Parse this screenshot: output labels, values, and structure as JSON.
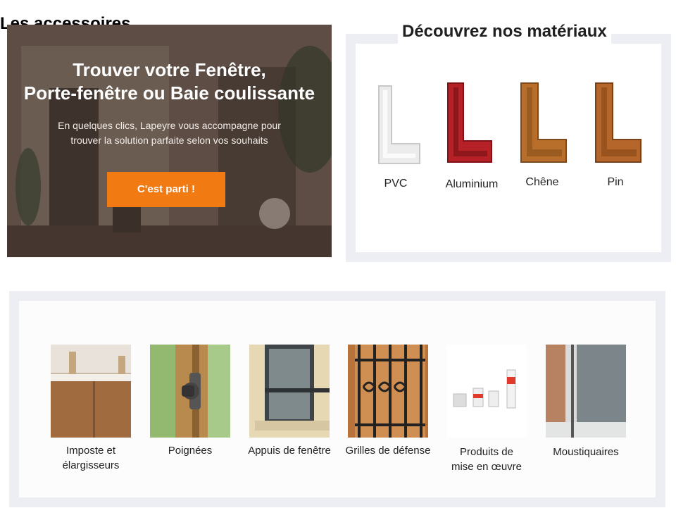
{
  "hero": {
    "title_line1": "Trouver votre Fenêtre,",
    "title_line2": "Porte-fenêtre ou Baie coulissante",
    "subtitle_line1": "En quelques clics, Lapeyre vous accompagne pour",
    "subtitle_line2": "trouver la solution parfaite selon vos souhaits",
    "cta_label": "C'est parti !",
    "accent_color": "#f27a12"
  },
  "materials": {
    "title": "Découvrez nos matériaux",
    "items": [
      {
        "label": "PVC",
        "color": "#f1f1f1"
      },
      {
        "label": "Aluminium",
        "color": "#b52126"
      },
      {
        "label": "Chêne",
        "color": "#b86f2c"
      },
      {
        "label": "Pin",
        "color": "#b5662a"
      }
    ]
  },
  "accessories": {
    "title": "Les accessoires",
    "items": [
      {
        "label_line1": "Imposte et",
        "label_line2": "élargisseurs"
      },
      {
        "label_line1": "Poignées",
        "label_line2": ""
      },
      {
        "label_line1": "Appuis de fenêtre",
        "label_line2": ""
      },
      {
        "label_line1": "Grilles de défense",
        "label_line2": ""
      },
      {
        "label_line1": "Produits de",
        "label_line2": "mise en œuvre"
      },
      {
        "label_line1": "Moustiquaires",
        "label_line2": ""
      }
    ]
  }
}
